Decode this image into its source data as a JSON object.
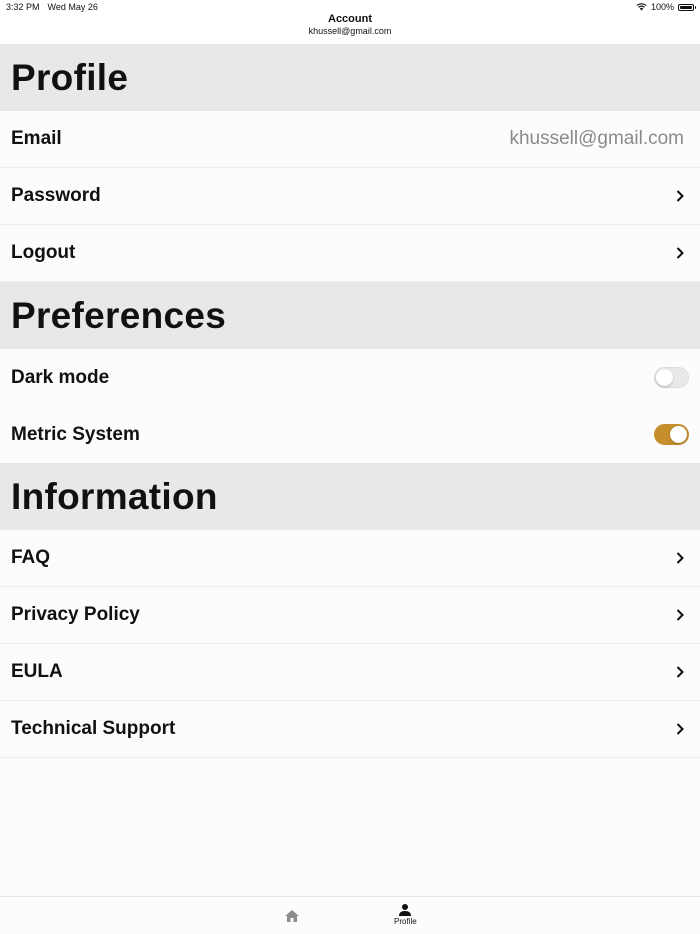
{
  "status_bar": {
    "time": "3:32 PM",
    "date": "Wed May 26",
    "battery": "100%"
  },
  "header": {
    "title": "Account",
    "subtitle": "khussell@gmail.com"
  },
  "sections": {
    "profile": {
      "title": "Profile",
      "email_label": "Email",
      "email_value": "khussell@gmail.com",
      "password_label": "Password",
      "logout_label": "Logout"
    },
    "preferences": {
      "title": "Preferences",
      "dark_mode_label": "Dark mode",
      "dark_mode_on": false,
      "metric_label": "Metric System",
      "metric_on": true
    },
    "information": {
      "title": "Information",
      "faq_label": "FAQ",
      "privacy_label": "Privacy Policy",
      "eula_label": "EULA",
      "support_label": "Technical Support"
    }
  },
  "tab_bar": {
    "home_icon": "home-icon",
    "profile_label": "Profile",
    "profile_icon": "person-icon"
  },
  "colors": {
    "accent": "#c68f2e",
    "section_bg": "#e8e8e8",
    "secondary_text": "#8a8a8a"
  }
}
